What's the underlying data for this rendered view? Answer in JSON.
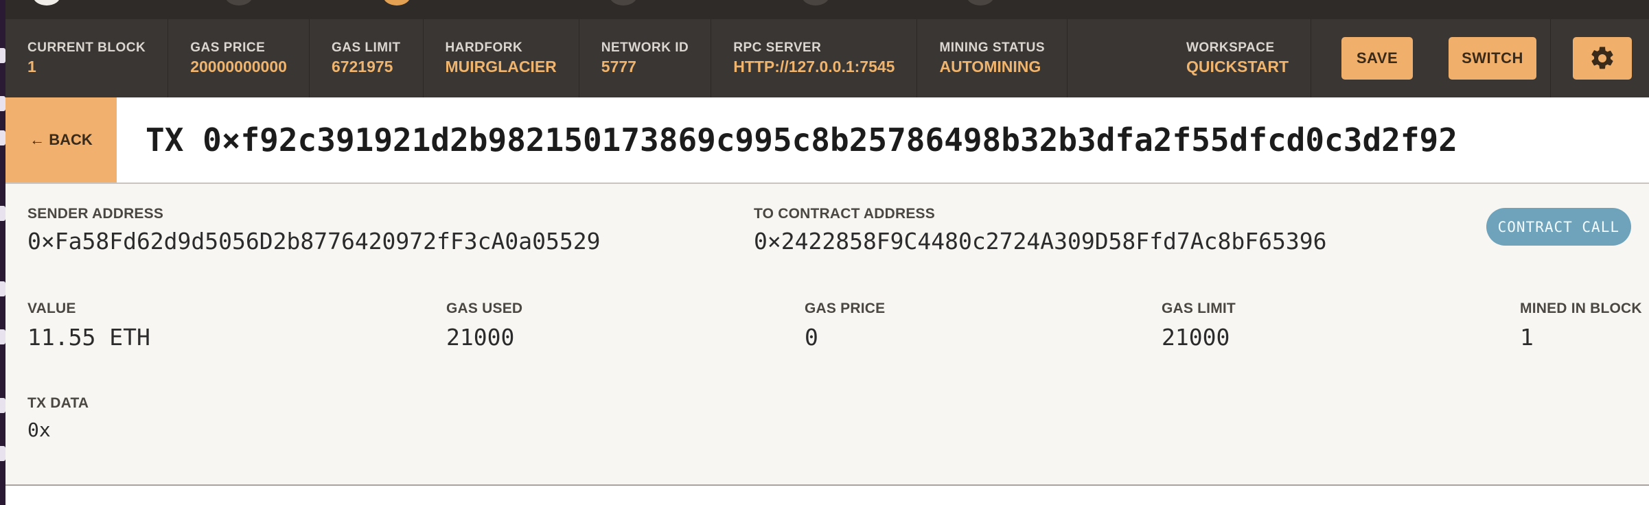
{
  "status_bar": {
    "items": [
      {
        "label": "CURRENT BLOCK",
        "value": "1"
      },
      {
        "label": "GAS PRICE",
        "value": "20000000000"
      },
      {
        "label": "GAS LIMIT",
        "value": "6721975"
      },
      {
        "label": "HARDFORK",
        "value": "MUIRGLACIER"
      },
      {
        "label": "NETWORK ID",
        "value": "5777"
      },
      {
        "label": "RPC SERVER",
        "value": "HTTP://127.0.0.1:7545"
      },
      {
        "label": "MINING STATUS",
        "value": "AUTOMINING"
      }
    ],
    "workspace": {
      "label": "WORKSPACE",
      "value": "QUICKSTART"
    },
    "save_label": "SAVE",
    "switch_label": "SWITCH"
  },
  "title_row": {
    "back_label": "← BACK",
    "title": "TX 0×f92c391921d2b982150173869c995c8b25786498b32b3dfa2f55dfcd0c3d2f92"
  },
  "details": {
    "sender": {
      "label": "SENDER ADDRESS",
      "value": "0×Fa58Fd62d9d5056D2b8776420972fF3cA0a05529"
    },
    "to_contract": {
      "label": "TO CONTRACT ADDRESS",
      "value": "0×2422858F9C4480c2724A309D58Ffd7Ac8bF65396"
    },
    "badge": "CONTRACT CALL",
    "value": {
      "label": "VALUE",
      "value": "11.55 ETH"
    },
    "gas_used": {
      "label": "GAS USED",
      "value": "21000"
    },
    "gas_price": {
      "label": "GAS PRICE",
      "value": "0"
    },
    "gas_limit": {
      "label": "GAS LIMIT",
      "value": "21000"
    },
    "mined_in_block": {
      "label": "MINED IN BLOCK",
      "value": "1"
    },
    "tx_data": {
      "label": "TX DATA",
      "value": "0x"
    }
  },
  "colors": {
    "accent": "#f0b06c",
    "header_bg": "#3a3633",
    "header_value": "#efb46d",
    "badge": "#6ea3bb",
    "panel_bg": "#f8f6f2"
  },
  "icons": {
    "settings": "gear-icon",
    "back": "arrow-left"
  }
}
